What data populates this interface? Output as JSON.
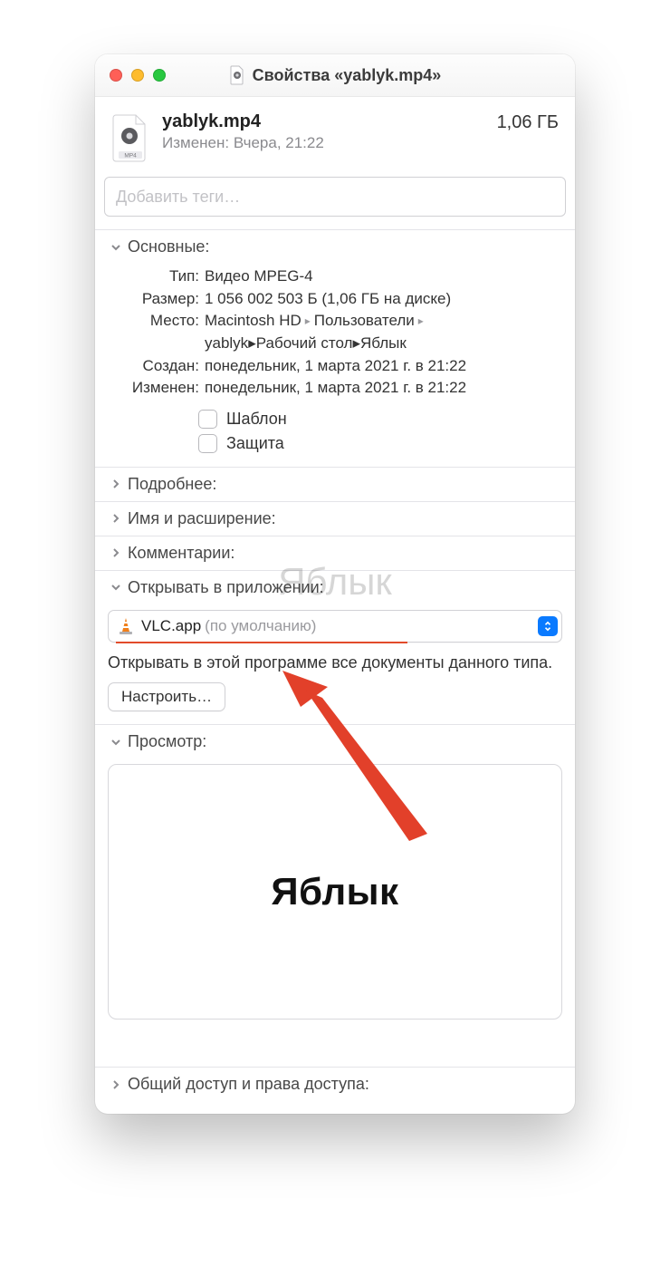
{
  "window": {
    "title": "Свойства «yablyk.mp4»"
  },
  "file": {
    "name": "yablyk.mp4",
    "modified_line": "Изменен: Вчера, 21:22",
    "size": "1,06 ГБ",
    "icon_ext": "MP4"
  },
  "tags": {
    "placeholder": "Добавить теги…"
  },
  "sections": {
    "general": {
      "title": "Основные:",
      "rows": {
        "type_label": "Тип:",
        "type_value": "Видео MPEG-4",
        "size_label": "Размер:",
        "size_value": "1 056 002 503 Б (1,06 ГБ на диске)",
        "where_label": "Место:",
        "where_seg1": "Macintosh HD",
        "where_seg2": "Пользователи",
        "where_seg3": "yablyk",
        "where_seg4": "Рабочий стол",
        "where_seg5": "Яблык",
        "created_label": "Создан:",
        "created_value": "понедельник, 1 марта 2021 г. в 21:22",
        "modified_label": "Изменен:",
        "modified_value": "понедельник, 1 марта 2021 г. в 21:22",
        "chk_template": "Шаблон",
        "chk_locked": "Защита"
      }
    },
    "more": {
      "title": "Подробнее:"
    },
    "name_ext": {
      "title": "Имя и расширение:"
    },
    "comments": {
      "title": "Комментарии:"
    },
    "open_with": {
      "title": "Открывать в приложении:",
      "app": "VLC.app",
      "default_suffix": "(по умолчанию)",
      "description": "Открывать в этой программе все документы данного типа.",
      "change_all_btn": "Настроить…"
    },
    "preview": {
      "title": "Просмотр:",
      "content": "Яблык"
    },
    "sharing": {
      "title": "Общий доступ и права доступа:"
    }
  },
  "watermark": "Яблык"
}
